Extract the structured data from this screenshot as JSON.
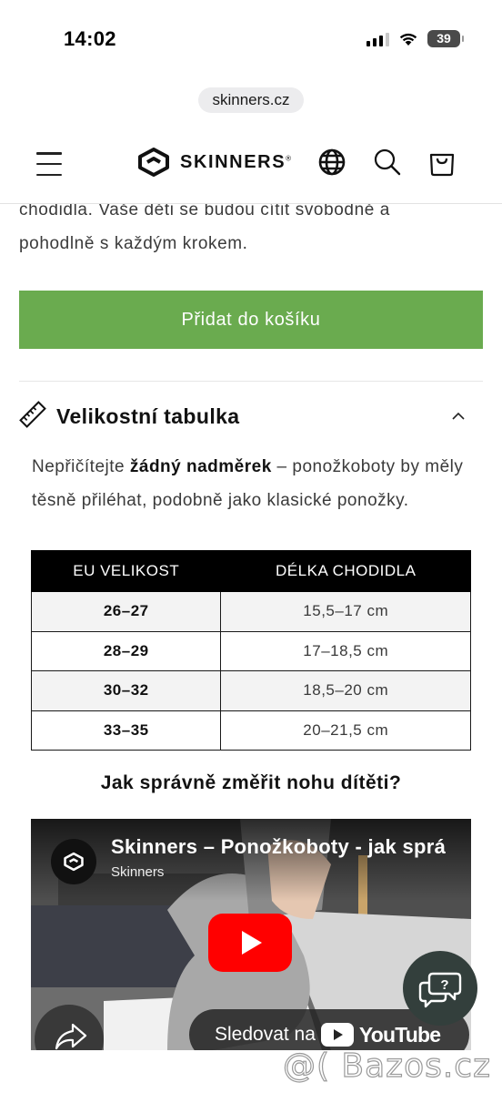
{
  "status_bar": {
    "time": "14:02",
    "battery": "39"
  },
  "browser": {
    "url": "skinners.cz"
  },
  "header": {
    "brand": "SKINNERS",
    "brand_mark": "®",
    "icons": [
      "menu-icon",
      "globe-icon",
      "search-icon",
      "cart-icon"
    ]
  },
  "product": {
    "description_line1": "chodidla. Vaše děti se budou cítit svobodně a",
    "description_line2": "pohodlně s každým krokem.",
    "add_to_cart_label": "Přidat do košíku"
  },
  "size_guide": {
    "title": "Velikostní tabulka",
    "intro_before": "Nepřičítejte ",
    "intro_bold": "žádný nadměrek",
    "intro_after": " – ponožkoboty by měly těsně přiléhat, podobně jako klasické ponožky.",
    "table": {
      "headers": [
        "EU VELIKOST",
        "DÉLKA CHODIDLA"
      ],
      "rows": [
        {
          "eu": "26–27",
          "length": "15,5–17 cm"
        },
        {
          "eu": "28–29",
          "length": "17–18,5 cm"
        },
        {
          "eu": "30–32",
          "length": "18,5–20 cm"
        },
        {
          "eu": "33–35",
          "length": "20–21,5 cm"
        }
      ]
    },
    "measure_title": "Jak správně změřit nohu dítěti?"
  },
  "video": {
    "title": "Skinners – Ponožkoboty - jak sprá",
    "channel": "Skinners",
    "watch_on_label": "Sledovat na",
    "youtube_word": "YouTube"
  },
  "watermark": "@( Bazos.cz",
  "colors": {
    "accent_green": "#6aab4f",
    "table_header": "#000000",
    "youtube_red": "#ff0000",
    "chat_bg": "#333f3c"
  }
}
